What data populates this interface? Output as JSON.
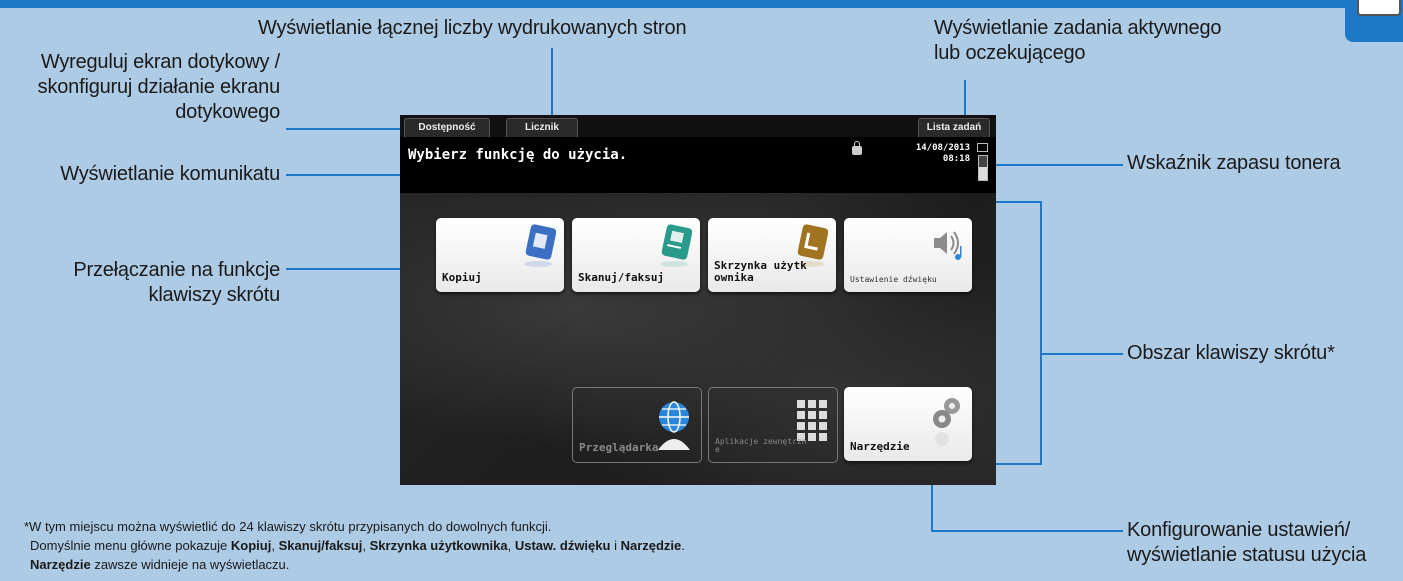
{
  "callouts": {
    "adjust": [
      "Wyreguluj ekran dotykowy /",
      "skonfiguruj działanie ekranu",
      "dotykowego"
    ],
    "message": "Wyświetlanie komunikatu",
    "shortcut_switch": [
      "Przełączanie na funkcje",
      "klawiszy skrótu"
    ],
    "counter": "Wyświetlanie łącznej liczby wydrukowanych stron",
    "job": [
      "Wyświetlanie zadania aktywnego",
      "lub oczekującego"
    ],
    "toner": "Wskaźnik zapasu tonera",
    "shortcut_area": "Obszar klawiszy skrótu*",
    "settings": [
      "Konfigurowanie ustawień/",
      "wyświetlanie statusu użycia"
    ]
  },
  "screen": {
    "tabs": {
      "accessibility": "Dostępność",
      "counter": "Licznik",
      "job_list": "Lista zadań"
    },
    "message": "Wybierz funkcję do użycia.",
    "date": "14/08/2013",
    "time": "08:18",
    "toner_level": 0.55,
    "keys": {
      "copy": "Kopiuj",
      "scan": "Skanuj/faksuj",
      "box": "Skrzynka użytkownika",
      "sound": "Ustawienie dźwięku",
      "browser": "Przeglądarka",
      "apps": "Aplikacje zewnętrzne",
      "utility": "Narzędzie"
    },
    "icons": {
      "copy": "copy-icon",
      "scan": "scan-fax-icon",
      "box": "user-box-icon",
      "sound": "sound-icon",
      "browser": "globe-icon",
      "apps": "apps-grid-icon",
      "utility": "gear-icon"
    }
  },
  "footnote": {
    "line1": "*W tym miejscu można wyświetlić do 24 klawiszy skrótu przypisanych do dowolnych funkcji.",
    "line2_prefix": "Domyślnie menu główne pokazuje ",
    "kw1": "Kopiuj",
    "sep1": ", ",
    "kw2": "Skanuj/faksuj",
    "sep2": ", ",
    "kw3": "Skrzynka użytkownika",
    "sep3": ", ",
    "kw4": "Ustaw. dźwięku",
    "sep4": " i ",
    "kw5": "Narzędzie",
    "line2_suffix": ".",
    "kw6": "Narzędzie",
    "line3_suffix": " zawsze widnieje na wyświetlaczu."
  },
  "colors": {
    "accent": "#1e78c8",
    "background": "#aecbe6",
    "screen": "#161616"
  }
}
